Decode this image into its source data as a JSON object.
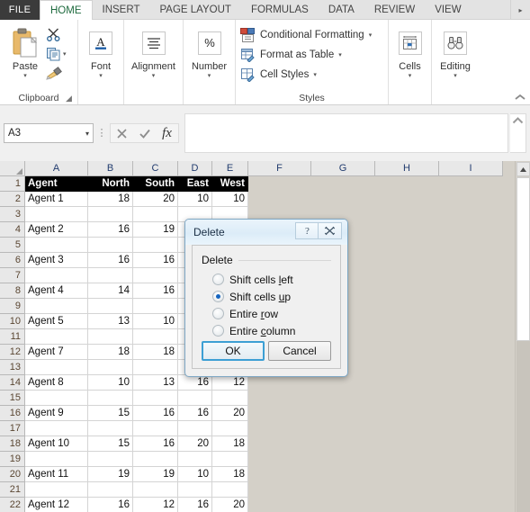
{
  "window": {
    "app": "Excel"
  },
  "tabs": {
    "file_label": "FILE",
    "items": [
      {
        "label": "HOME",
        "active": true
      },
      {
        "label": "INSERT",
        "active": false
      },
      {
        "label": "PAGE LAYOUT",
        "active": false
      },
      {
        "label": "FORMULAS",
        "active": false
      },
      {
        "label": "DATA",
        "active": false
      },
      {
        "label": "REVIEW",
        "active": false
      },
      {
        "label": "VIEW",
        "active": false
      }
    ],
    "overflow_icon": "chevron-right-icon"
  },
  "ribbon": {
    "clipboard": {
      "group_label": "Clipboard",
      "paste_label": "Paste",
      "paste_caret": "▾",
      "cut_icon": "scissors-icon",
      "copy_icon": "copy-icon",
      "copy_caret": "▾",
      "format_painter_icon": "format-painter-icon",
      "launcher_icon": "dialog-launcher-icon"
    },
    "font": {
      "group_label": "Font",
      "label": "Font",
      "caret": "▾",
      "icon": "font-a-icon"
    },
    "alignment": {
      "group_label": "Alignment",
      "label": "Alignment",
      "caret": "▾",
      "icon": "align-lines-icon"
    },
    "number": {
      "group_label": "Number",
      "label": "Number",
      "caret": "▾",
      "icon": "percent-icon"
    },
    "styles": {
      "group_label": "Styles",
      "items": [
        {
          "label": "Conditional Formatting",
          "caret": "▾",
          "icon": "conditional-formatting-icon"
        },
        {
          "label": "Format as Table",
          "caret": "▾",
          "icon": "format-as-table-icon"
        },
        {
          "label": "Cell Styles",
          "caret": "▾",
          "icon": "cell-styles-icon"
        }
      ]
    },
    "cells": {
      "group_label": "",
      "label": "Cells",
      "caret": "▾",
      "icon": "cells-insert-icon"
    },
    "editing": {
      "group_label": "",
      "label": "Editing",
      "caret": "▾",
      "icon": "binoculars-icon"
    },
    "collapse_icon": "chevron-up-icon"
  },
  "formula_bar": {
    "name_box_value": "A3",
    "name_box_caret": "▾",
    "drag_handle_icon": "vertical-dots-icon",
    "cancel_icon": "cancel-x-icon",
    "enter_icon": "enter-check-icon",
    "function_icon": "fx-icon",
    "input_value": "",
    "input_placeholder": "",
    "expand_icon": "chevron-up-icon"
  },
  "grid": {
    "columns": [
      {
        "label": "A",
        "width": 70
      },
      {
        "label": "B",
        "width": 50
      },
      {
        "label": "C",
        "width": 50
      },
      {
        "label": "D",
        "width": 38
      },
      {
        "label": "E",
        "width": 40
      },
      {
        "label": "F",
        "width": 70
      },
      {
        "label": "G",
        "width": 71
      },
      {
        "label": "H",
        "width": 71
      },
      {
        "label": "I",
        "width": 71
      }
    ],
    "row_numbers": [
      1,
      2,
      3,
      4,
      5,
      6,
      7,
      8,
      9,
      10,
      11,
      12,
      13,
      14,
      15,
      16,
      17,
      18,
      19,
      20,
      21,
      22
    ],
    "header_row_index": 1,
    "rows": [
      {
        "n": 1,
        "header": true,
        "cells": [
          "Agent",
          "North",
          "South",
          "East",
          "West"
        ]
      },
      {
        "n": 2,
        "cells": [
          "Agent 1",
          "18",
          "20",
          "10",
          "10"
        ]
      },
      {
        "n": 3,
        "cells": [
          "",
          "",
          "",
          "",
          ""
        ]
      },
      {
        "n": 4,
        "cells": [
          "Agent 2",
          "16",
          "19",
          "",
          ""
        ]
      },
      {
        "n": 5,
        "cells": [
          "",
          "",
          "",
          "",
          ""
        ]
      },
      {
        "n": 6,
        "cells": [
          "Agent 3",
          "16",
          "16",
          "",
          ""
        ]
      },
      {
        "n": 7,
        "cells": [
          "",
          "",
          "",
          "",
          ""
        ]
      },
      {
        "n": 8,
        "cells": [
          "Agent 4",
          "14",
          "16",
          "",
          ""
        ]
      },
      {
        "n": 9,
        "cells": [
          "",
          "",
          "",
          "",
          ""
        ]
      },
      {
        "n": 10,
        "cells": [
          "Agent 5",
          "13",
          "10",
          "",
          ""
        ]
      },
      {
        "n": 11,
        "cells": [
          "",
          "",
          "",
          "",
          ""
        ]
      },
      {
        "n": 12,
        "cells": [
          "Agent 7",
          "18",
          "18",
          "",
          ""
        ]
      },
      {
        "n": 13,
        "cells": [
          "",
          "",
          "",
          "",
          ""
        ]
      },
      {
        "n": 14,
        "cells": [
          "Agent 8",
          "10",
          "13",
          "16",
          "12"
        ]
      },
      {
        "n": 15,
        "cells": [
          "",
          "",
          "",
          "",
          ""
        ]
      },
      {
        "n": 16,
        "cells": [
          "Agent 9",
          "15",
          "16",
          "16",
          "20"
        ]
      },
      {
        "n": 17,
        "cells": [
          "",
          "",
          "",
          "",
          ""
        ]
      },
      {
        "n": 18,
        "cells": [
          "Agent 10",
          "15",
          "16",
          "20",
          "18"
        ]
      },
      {
        "n": 19,
        "cells": [
          "",
          "",
          "",
          "",
          ""
        ]
      },
      {
        "n": 20,
        "cells": [
          "Agent 11",
          "19",
          "19",
          "10",
          "18"
        ]
      },
      {
        "n": 21,
        "cells": [
          "",
          "",
          "",
          "",
          ""
        ]
      },
      {
        "n": 22,
        "cells": [
          "Agent 12",
          "16",
          "12",
          "16",
          "20"
        ]
      }
    ],
    "scrollbar": {
      "up_icon": "triangle-up-icon"
    }
  },
  "dialog": {
    "title": "Delete",
    "help_icon": "question-help-icon",
    "close_icon": "close-x-icon",
    "group_label": "Delete",
    "options": [
      {
        "label_pre": "Shift cells ",
        "accel": "l",
        "label_post": "eft",
        "selected": false,
        "name": "shift-cells-left"
      },
      {
        "label_pre": "Shift cells ",
        "accel": "u",
        "label_post": "p",
        "selected": true,
        "name": "shift-cells-up"
      },
      {
        "label_pre": "Entire ",
        "accel": "r",
        "label_post": "ow",
        "selected": false,
        "name": "entire-row"
      },
      {
        "label_pre": "Entire ",
        "accel": "c",
        "label_post": "olumn",
        "selected": false,
        "name": "entire-column"
      }
    ],
    "ok_label": "OK",
    "cancel_label": "Cancel"
  },
  "colors": {
    "accent": "#1565c0",
    "tab_active_text": "#1f6b3f",
    "file_tab_bg": "#3b3b3b",
    "header_row_bg": "#000000",
    "grid_line": "#d4d4d4",
    "dialog_border": "#7ea7c4"
  }
}
